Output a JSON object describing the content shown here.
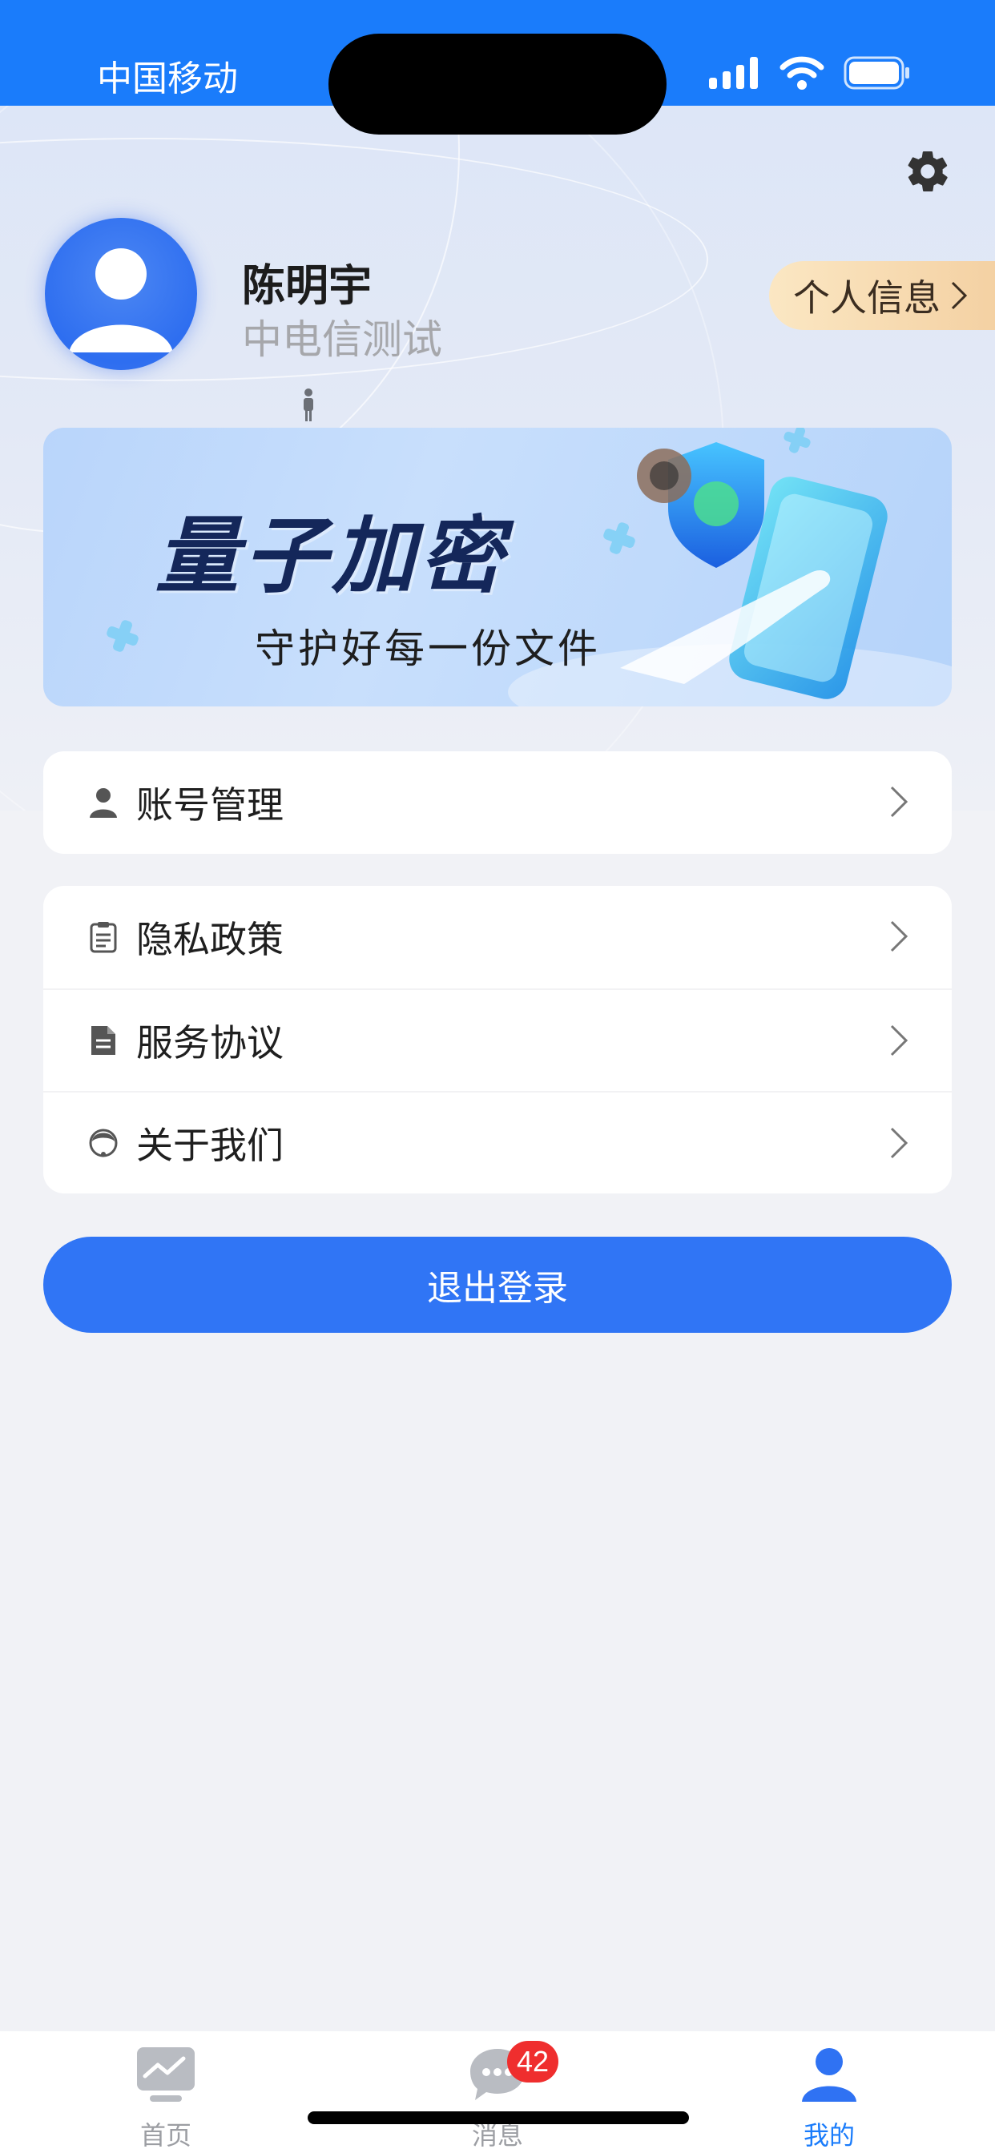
{
  "status_bar": {
    "carrier": "中国移动"
  },
  "profile": {
    "name": "陈明宇",
    "org": "中电信测试",
    "info_button": "个人信息"
  },
  "banner": {
    "title": "量子加密",
    "subtitle": "守护好每一份文件"
  },
  "menu_top": [
    {
      "label": "账号管理",
      "icon": "person-icon"
    }
  ],
  "menu_bottom": [
    {
      "label": "隐私政策",
      "icon": "clipboard-icon"
    },
    {
      "label": "服务协议",
      "icon": "document-icon"
    },
    {
      "label": "关于我们",
      "icon": "headset-icon"
    }
  ],
  "logout_label": "退出登录",
  "tabs": [
    {
      "label": "首页",
      "icon": "chart-icon",
      "active": false
    },
    {
      "label": "消息",
      "icon": "chat-icon",
      "active": false,
      "badge": "42"
    },
    {
      "label": "我的",
      "icon": "user-icon",
      "active": true
    }
  ],
  "colors": {
    "accent": "#1a7cfb",
    "button": "#3075f5",
    "badge": "#ef2e2e"
  }
}
